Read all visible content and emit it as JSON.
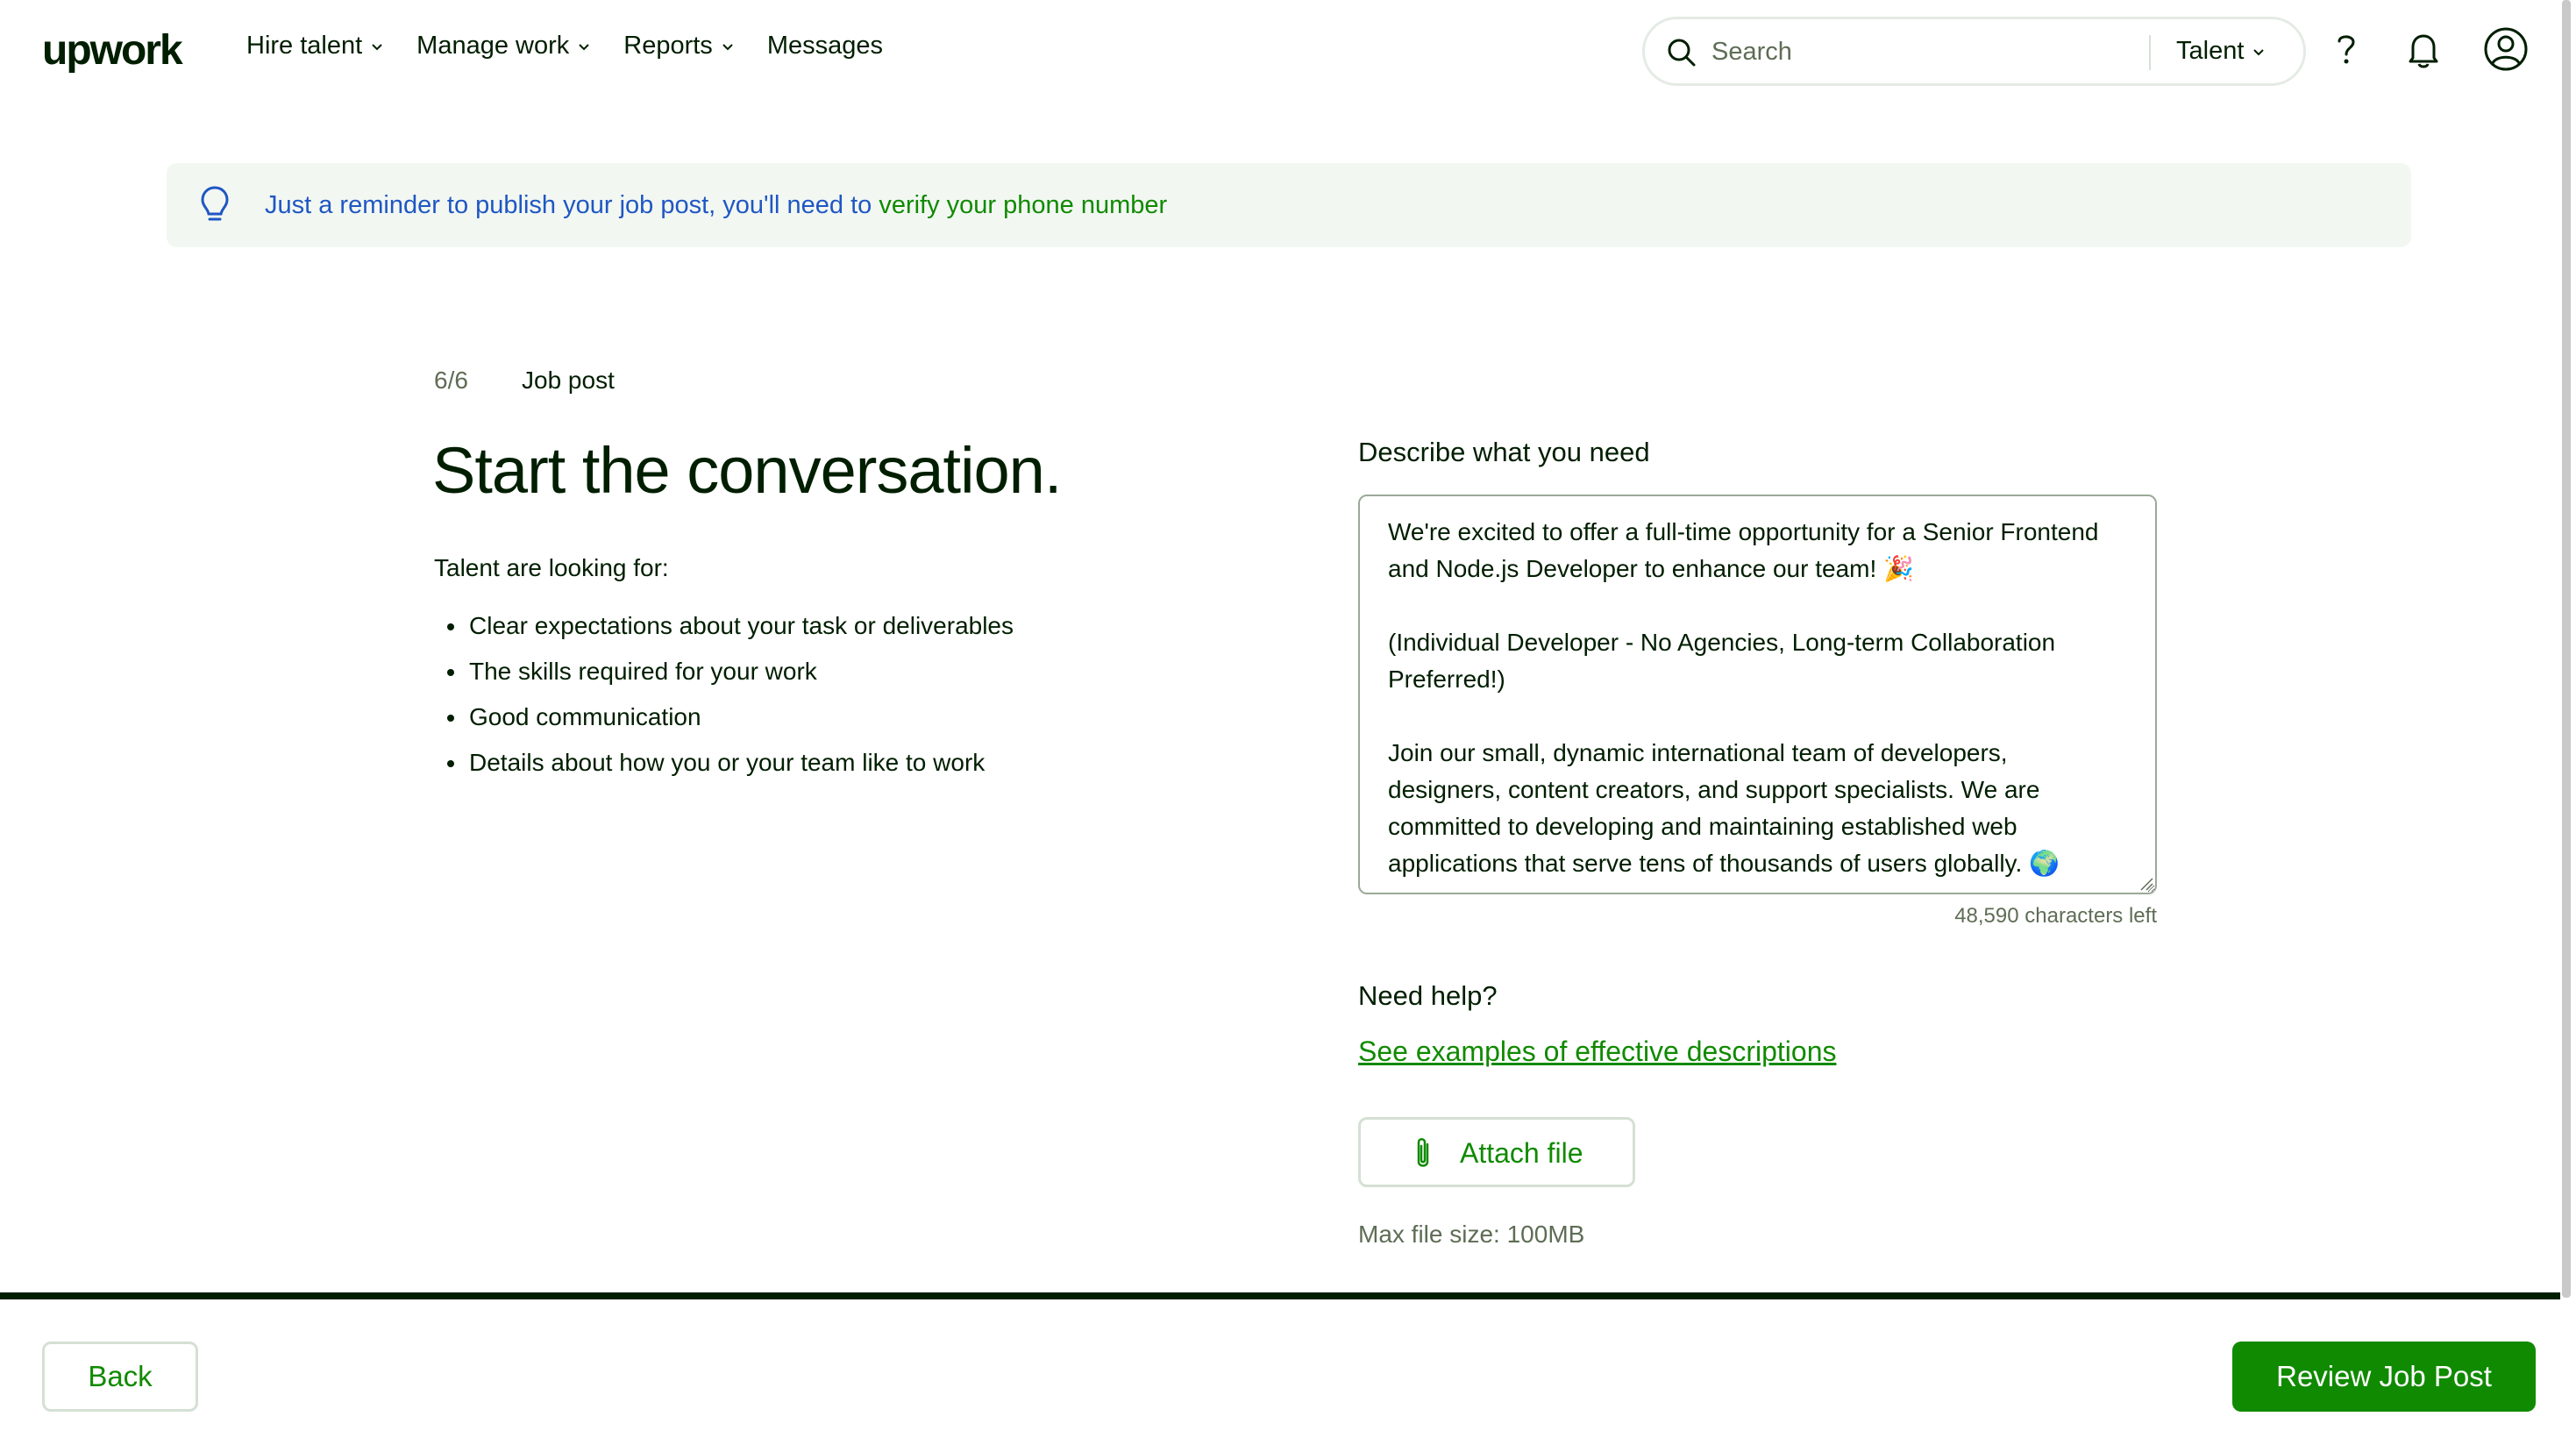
{
  "nav": {
    "logo": "upwork",
    "links": [
      {
        "label": "Hire talent",
        "has_dropdown": true
      },
      {
        "label": "Manage work",
        "has_dropdown": true
      },
      {
        "label": "Reports",
        "has_dropdown": true
      },
      {
        "label": "Messages",
        "has_dropdown": false
      }
    ],
    "search": {
      "placeholder": "Search",
      "scope": "Talent",
      "icon": "search-icon"
    },
    "icons": [
      "help-icon",
      "bell-icon",
      "account-icon"
    ]
  },
  "banner": {
    "icon": "lightbulb-icon",
    "text": "Just a reminder to publish your job post, you'll need to ",
    "link": "verify your phone number"
  },
  "step": {
    "counter": "6/6",
    "name": "Job post"
  },
  "heading": "Start the conversation.",
  "intro": "Talent are looking for:",
  "tips": [
    "Clear expectations about your task or deliverables",
    "The skills required for your work",
    "Good communication",
    "Details about how you or your team like to work"
  ],
  "description": {
    "label": "Describe what you need",
    "value": "We're excited to offer a full-time opportunity for a Senior Frontend and Node.js Developer to enhance our team! 🎉\n\n(Individual Developer - No Agencies, Long-term Collaboration Preferred!)\n\nJoin our small, dynamic international team of developers, designers, content creators, and support specialists. We are committed to developing and maintaining established web applications that serve tens of thousands of users globally. 🌍",
    "chars_left": "48,590 characters left"
  },
  "help": {
    "label": "Need help?",
    "link": "See examples of effective descriptions"
  },
  "attach": {
    "label": "Attach file",
    "icon": "paperclip-icon",
    "max_size": "Max file size: 100MB"
  },
  "footer": {
    "back": "Back",
    "review": "Review Job Post"
  },
  "colors": {
    "brand_green": "#108a00",
    "text": "#001e00",
    "banner_bg": "#f2f7f2",
    "banner_text": "#1f57c3"
  }
}
